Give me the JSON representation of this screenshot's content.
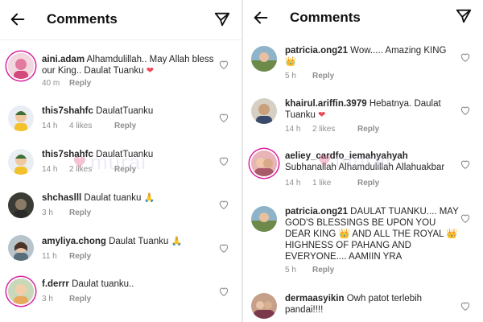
{
  "left": {
    "header": {
      "title": "Comments"
    },
    "watermark": "murai",
    "comments": [
      {
        "username": "aini.adam",
        "text": "Alhamdulillah.. May Allah bless our King.. Daulat Tuanku",
        "emoji": "❤",
        "time": "40 m",
        "likes": "",
        "reply": "Reply"
      },
      {
        "username": "this7shahfc",
        "text": "DaulatTuanku",
        "emoji": "",
        "time": "14 h",
        "likes": "4 likes",
        "reply": "Reply"
      },
      {
        "username": "this7shahfc",
        "text": "DaulatTuanku",
        "emoji": "",
        "time": "14 h",
        "likes": "2 likes",
        "reply": "Reply"
      },
      {
        "username": "shchaslll",
        "text": "Daulat tuanku",
        "emoji": "🙏",
        "time": "3 h",
        "likes": "",
        "reply": "Reply"
      },
      {
        "username": "amyliya.chong",
        "text": "Daulat Tuanku",
        "emoji": "🙏",
        "time": "11 h",
        "likes": "",
        "reply": "Reply"
      },
      {
        "username": "f.derrr",
        "text": "Daulat tuanku..",
        "emoji": "",
        "time": "3 h",
        "likes": "",
        "reply": "Reply"
      }
    ]
  },
  "right": {
    "header": {
      "title": "Comments"
    },
    "watermark": "murai",
    "comments": [
      {
        "username": "patricia.ong21",
        "text": "Wow..... Amazing KING",
        "emoji": "👑",
        "time": "5 h",
        "likes": "",
        "reply": "Reply"
      },
      {
        "username": "khairul.ariffin.3979",
        "text": "Hebatnya. Daulat Tuanku",
        "emoji": "❤",
        "time": "14 h",
        "likes": "2 likes",
        "reply": "Reply"
      },
      {
        "username": "aeliey_cardfo_iemahyahyah",
        "text": "Subhanallah Alhamdulillah Allahuakbar",
        "emoji": "",
        "time": "14 h",
        "likes": "1 like",
        "reply": "Reply"
      },
      {
        "username": "patricia.ong21",
        "text": "DAULAT TUANKU.... MAY GOD'S BLESSINGS BE UPON YOU DEAR KING 👑 AND ALL THE ROYAL 👑 HIGHNESS OF PAHANG AND EVERYONE.... AAMIIN YRA",
        "emoji": "",
        "time": "5 h",
        "likes": "",
        "reply": "Reply"
      },
      {
        "username": "dermaasyikin",
        "text": "Owh patot terlebih pandai!!!!",
        "emoji": "",
        "time": "",
        "likes": "",
        "reply": ""
      }
    ]
  },
  "colors": {
    "accent": "#d6249f",
    "heart": "#ed4956",
    "meta": "#8e8e8e",
    "text": "#262626"
  },
  "icons": {
    "back": "arrow-left-icon",
    "send": "paper-plane-icon",
    "like": "heart-outline-icon"
  }
}
